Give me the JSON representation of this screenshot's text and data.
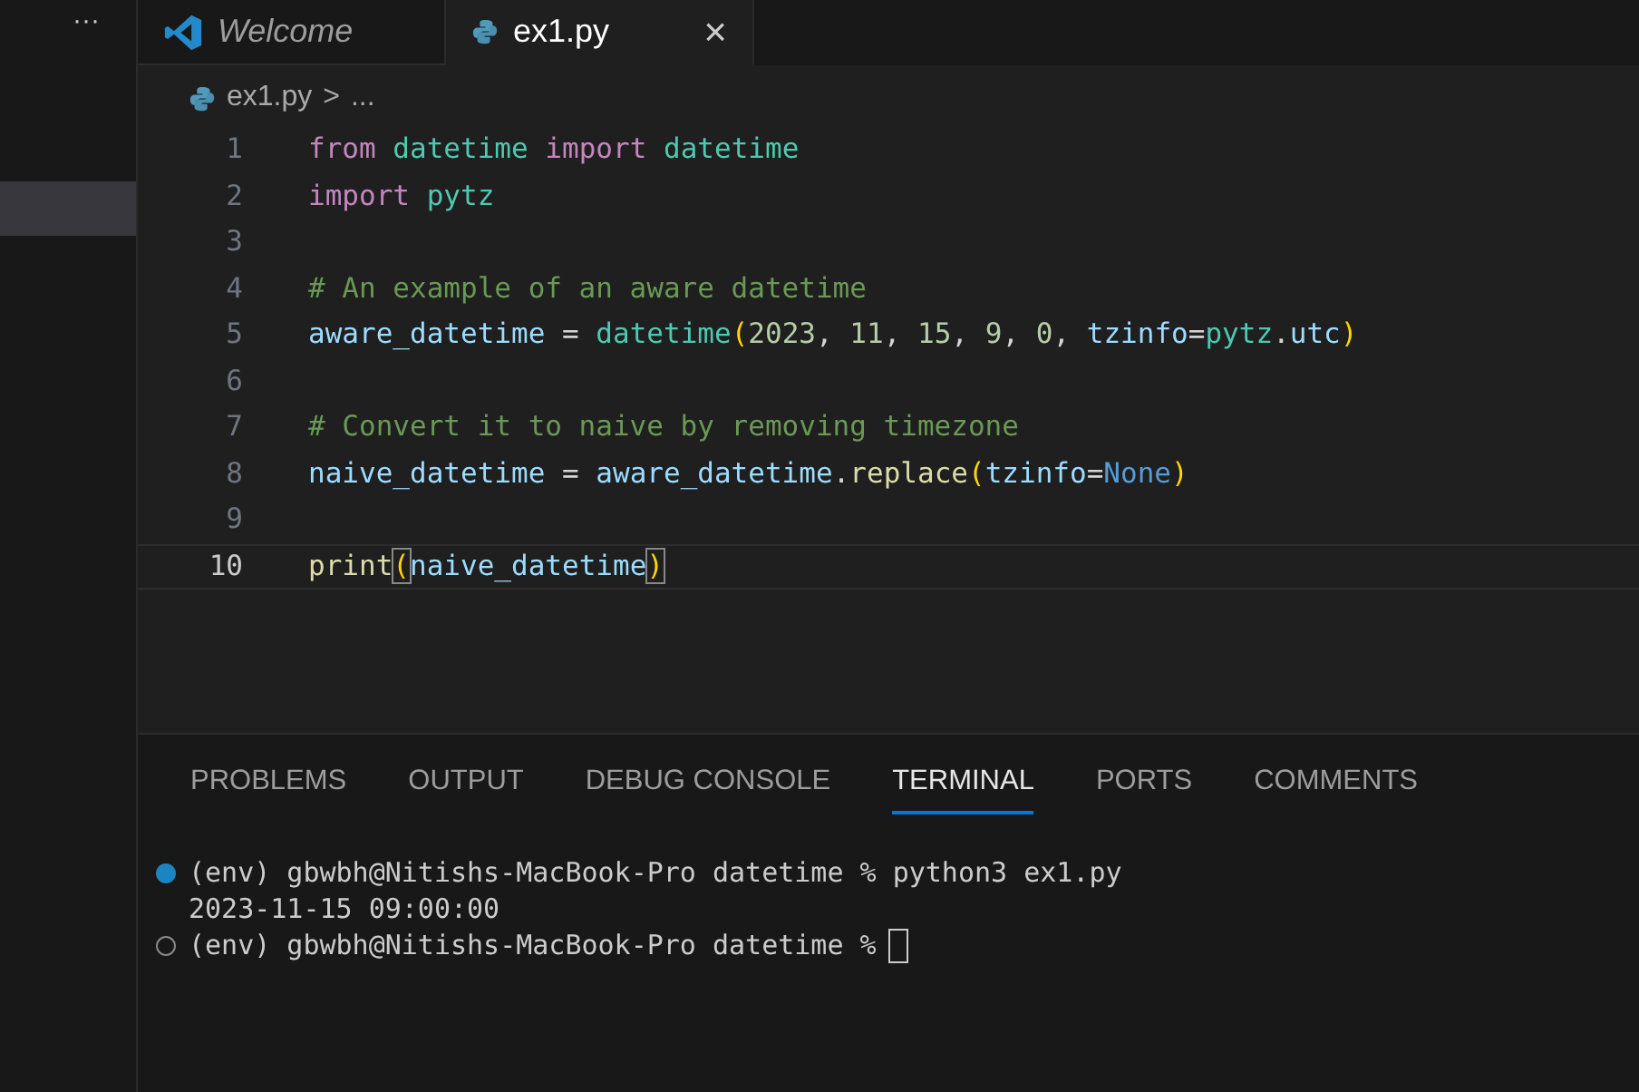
{
  "sidebar": {
    "more": "···",
    "items": [
      {
        "selected": true
      }
    ]
  },
  "tabs": [
    {
      "label": "Welcome",
      "kind": "welcome",
      "selected": false,
      "preview": true
    },
    {
      "label": "ex1.py",
      "kind": "python",
      "selected": true,
      "preview": false,
      "close": "×"
    }
  ],
  "breadcrumb": {
    "file": "ex1.py",
    "separator": ">",
    "rest": "..."
  },
  "code": [
    {
      "number": "1",
      "current": false,
      "tokens": [
        {
          "t": "from ",
          "kind": "keyword"
        },
        {
          "t": "datetime ",
          "kind": "class"
        },
        {
          "t": "import ",
          "kind": "keyword"
        },
        {
          "t": "datetime",
          "kind": "class"
        }
      ]
    },
    {
      "number": "2",
      "current": false,
      "tokens": [
        {
          "t": "import ",
          "kind": "keyword"
        },
        {
          "t": "pytz",
          "kind": "class"
        }
      ]
    },
    {
      "number": "3",
      "current": false
    },
    {
      "number": "4",
      "current": false,
      "tokens": [
        {
          "t": "# An example of an aware datetime",
          "kind": "comment"
        }
      ]
    },
    {
      "number": "5",
      "current": false,
      "tokens": [
        {
          "t": "aware_datetime",
          "kind": "variable"
        },
        {
          "t": " = ",
          "kind": "plain"
        },
        {
          "t": "datetime",
          "kind": "class"
        },
        {
          "t": "(",
          "kind": "bracket"
        },
        {
          "t": "2023",
          "kind": "number"
        },
        {
          "t": ", ",
          "kind": "plain"
        },
        {
          "t": "11",
          "kind": "number"
        },
        {
          "t": ", ",
          "kind": "plain"
        },
        {
          "t": "15",
          "kind": "number"
        },
        {
          "t": ", ",
          "kind": "plain"
        },
        {
          "t": "9",
          "kind": "number"
        },
        {
          "t": ", ",
          "kind": "plain"
        },
        {
          "t": "0",
          "kind": "number"
        },
        {
          "t": ", ",
          "kind": "plain"
        },
        {
          "t": "tzinfo",
          "kind": "variable"
        },
        {
          "t": "=",
          "kind": "plain"
        },
        {
          "t": "pytz",
          "kind": "class"
        },
        {
          "t": ".",
          "kind": "plain"
        },
        {
          "t": "utc",
          "kind": "variable"
        },
        {
          "t": ")",
          "kind": "bracket"
        }
      ]
    },
    {
      "number": "6",
      "current": false
    },
    {
      "number": "7",
      "current": false,
      "tokens": [
        {
          "t": "# Convert it to naive by removing timezone",
          "kind": "comment"
        }
      ]
    },
    {
      "number": "8",
      "current": false,
      "tokens": [
        {
          "t": "naive_datetime",
          "kind": "variable"
        },
        {
          "t": " = ",
          "kind": "plain"
        },
        {
          "t": "aware_datetime",
          "kind": "variable"
        },
        {
          "t": ".",
          "kind": "plain"
        },
        {
          "t": "replace",
          "kind": "function"
        },
        {
          "t": "(",
          "kind": "bracket"
        },
        {
          "t": "tzinfo",
          "kind": "variable"
        },
        {
          "t": "=",
          "kind": "plain"
        },
        {
          "t": "None",
          "kind": "constant"
        },
        {
          "t": ")",
          "kind": "bracket"
        }
      ]
    },
    {
      "number": "9",
      "current": false
    },
    {
      "number": "10",
      "current": true,
      "tokens": [
        {
          "t": "print",
          "kind": "function"
        },
        {
          "t": "(",
          "kind": "bracket-match"
        },
        {
          "t": "naive_datetime",
          "kind": "variable"
        },
        {
          "t": ")",
          "kind": "bracket-match"
        }
      ]
    }
  ],
  "panel_tabs": [
    {
      "label": "PROBLEMS",
      "selected": false
    },
    {
      "label": "OUTPUT",
      "selected": false
    },
    {
      "label": "DEBUG CONSOLE",
      "selected": false
    },
    {
      "label": "TERMINAL",
      "selected": true
    },
    {
      "label": "PORTS",
      "selected": false
    },
    {
      "label": "COMMENTS",
      "selected": false
    }
  ],
  "terminal": [
    {
      "kind": "prompt",
      "finished": true,
      "text": "(env) gbwbh@Nitishs-MacBook-Pro datetime % python3 ex1.py"
    },
    {
      "kind": "output",
      "text": "2023-11-15 09:00:00"
    },
    {
      "kind": "prompt",
      "finished": false,
      "cursor": true,
      "text": "(env) gbwbh@Nitishs-MacBook-Pro datetime %"
    }
  ]
}
